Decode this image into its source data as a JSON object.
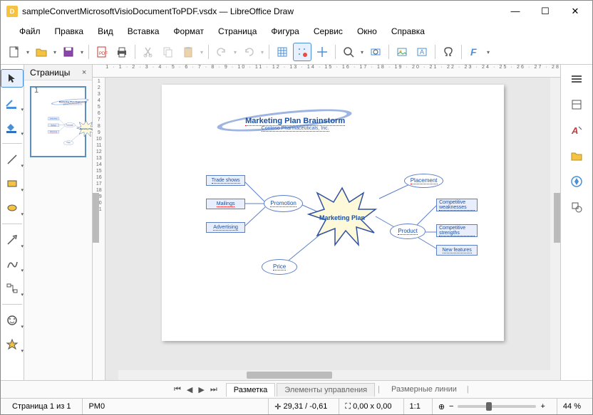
{
  "window": {
    "title": "sampleConvertMicrosoftVisioDocumentToPDF.vsdx — LibreOffice Draw"
  },
  "menu": [
    "Файл",
    "Правка",
    "Вид",
    "Вставка",
    "Формат",
    "Страница",
    "Фигура",
    "Сервис",
    "Окно",
    "Справка"
  ],
  "panel": {
    "title": "Страницы",
    "page_number": "1"
  },
  "ruler_h": "1 · 1 · 2 · 3 · 4 · 5 · 6 · 7 · 8 · 9 · 10 · 11 · 12 · 13 · 14 · 15 · 16 · 17 · 18 · 19 · 20 · 21 · 22 · 23 · 24 · 25 · 26 · 27 · 28",
  "ruler_v": [
    "1",
    "2",
    "3",
    "4",
    "5",
    "6",
    "7",
    "8",
    "9",
    "10",
    "11",
    "12",
    "13",
    "14",
    "15",
    "16",
    "17",
    "18",
    "19",
    "20",
    "21"
  ],
  "tabs": {
    "t1": "Разметка",
    "t2": "Элементы управления",
    "t3": "Размерные линии"
  },
  "status": {
    "page": "Страница 1 из 1",
    "layer": "PM0",
    "coords": "29,31 / -0,61",
    "size": "0,00 x 0,00",
    "scale": "1:1",
    "zoom": "44 %"
  },
  "diagram": {
    "title": "Marketing Plan Brainstorm",
    "subtitle": "Contoso Pharmaceuticals, Inc.",
    "center": "Marketing Plan",
    "promotion": "Promotion",
    "price": "Price",
    "placement": "Placement",
    "product": "Product",
    "trade_shows": "Trade shows",
    "mailings": "Mailings",
    "advertising": "Advertising",
    "comp_weaknesses": "Competitive weaknesses",
    "comp_strengths": "Competitive strengths",
    "new_features": "New features"
  }
}
